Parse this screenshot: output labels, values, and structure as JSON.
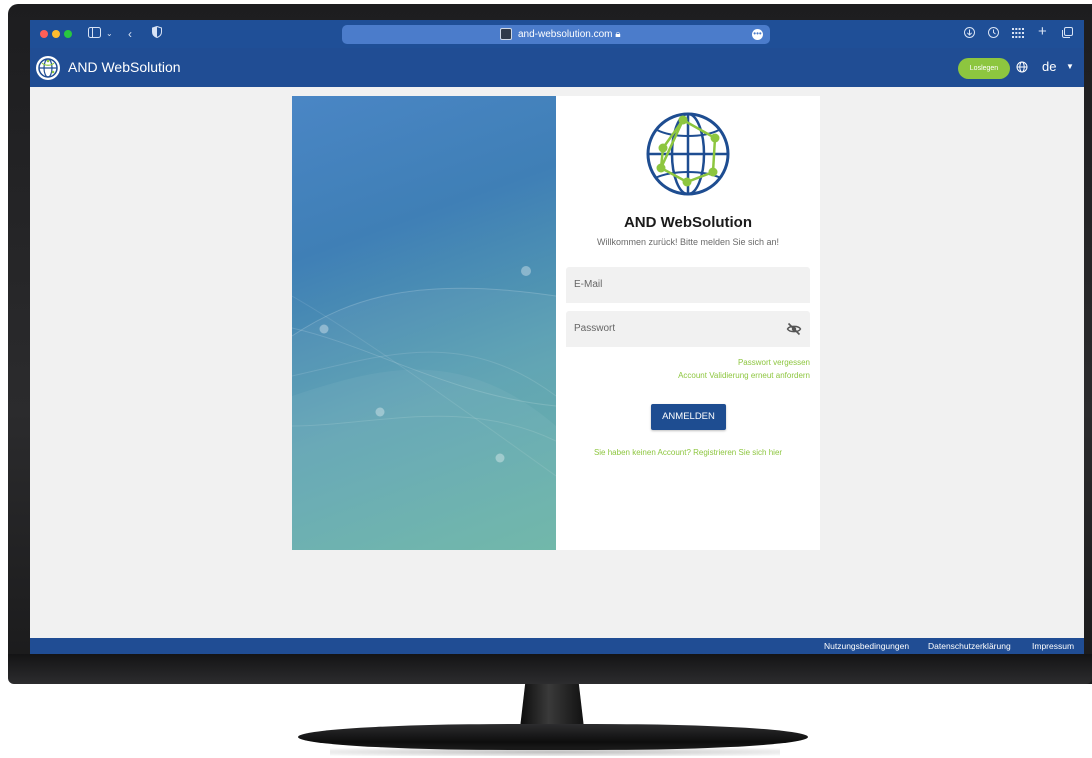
{
  "browser": {
    "url": "and-websolution.com",
    "icons": [
      "sidebar-icon",
      "chevron-down-icon",
      "back-icon",
      "shield-icon",
      "lock-icon",
      "more-icon",
      "download-icon",
      "history-icon",
      "grid-icon",
      "plus-icon",
      "tabs-icon"
    ]
  },
  "header": {
    "app_title": "AND WebSolution",
    "cta_label": "Loslegen",
    "language": "de"
  },
  "login": {
    "brand": "AND WebSolution",
    "welcome": "Willkommen zurück! Bitte melden Sie sich an!",
    "email_placeholder": "E-Mail",
    "password_placeholder": "Passwort",
    "forgot_link": "Passwort vergessen",
    "revalidate_link": "Account Validierung erneut anfordern",
    "submit_label": "ANMELDEN",
    "register_link": "Sie haben keinen Account? Registrieren Sie sich hier"
  },
  "footer": {
    "links": [
      "Nutzungsbedingungen",
      "Datenschutzerklärung",
      "Impressum"
    ]
  },
  "colors": {
    "primary": "#204d94",
    "accent": "#8dc63f",
    "background": "#f1f1f1"
  }
}
